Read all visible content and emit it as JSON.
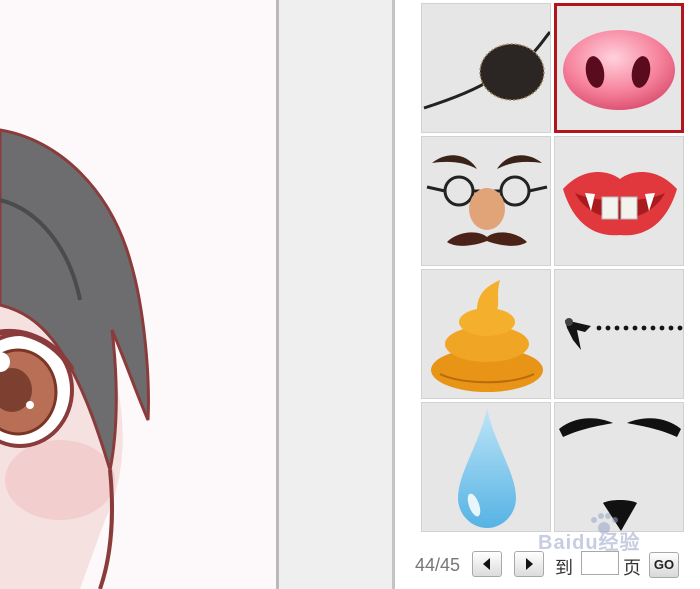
{
  "stickers": [
    {
      "name": "eye patch"
    },
    {
      "name": "pig nose",
      "selected": true
    },
    {
      "name": "nose glasses mustache"
    },
    {
      "name": "vampire lips"
    },
    {
      "name": "poop"
    },
    {
      "name": "fuse bomb"
    },
    {
      "name": "tear drop"
    },
    {
      "name": "mustache and goatee"
    }
  ],
  "pager": {
    "page_count": "44/45",
    "goto_label": "到",
    "page_label": "页",
    "page_input_value": "",
    "go_label": "GO"
  },
  "watermark": {
    "text": "Baidu经验"
  }
}
